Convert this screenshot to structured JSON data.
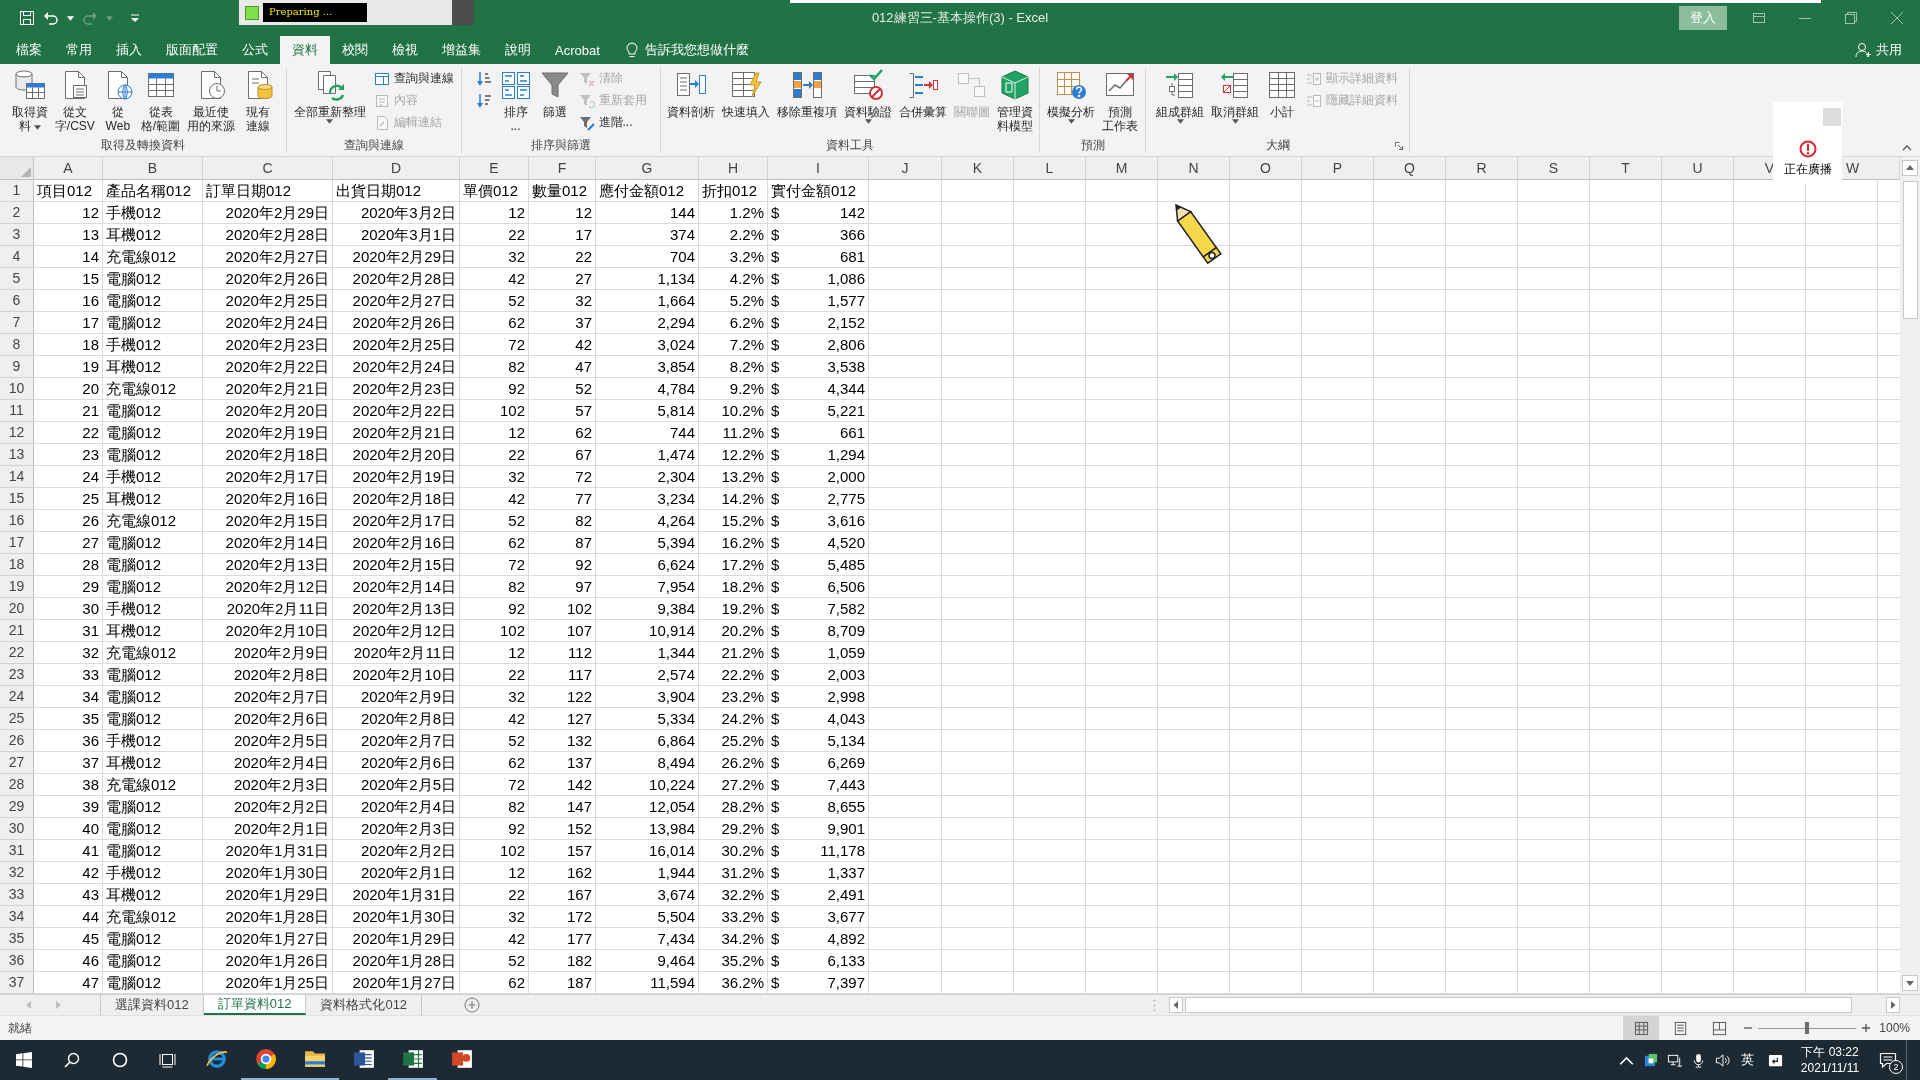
{
  "title_bar": {
    "recorder_status": "Preparing ...",
    "title": "012練習三-基本操作(3) - Excel",
    "sign_in": "登入"
  },
  "tabs": [
    {
      "label": "檔案",
      "selected": false
    },
    {
      "label": "常用",
      "selected": false
    },
    {
      "label": "插入",
      "selected": false
    },
    {
      "label": "版面配置",
      "selected": false
    },
    {
      "label": "公式",
      "selected": false
    },
    {
      "label": "資料",
      "selected": true
    },
    {
      "label": "校閱",
      "selected": false
    },
    {
      "label": "檢視",
      "selected": false
    },
    {
      "label": "增益集",
      "selected": false
    },
    {
      "label": "說明",
      "selected": false
    },
    {
      "label": "Acrobat",
      "selected": false
    }
  ],
  "tell_me": "告訴我您想做什麼",
  "share": "共用",
  "ribbon": [
    {
      "label": "取得及轉換資料",
      "launcher": false,
      "items": [
        {
          "kind": "large",
          "lines": [
            "取得資",
            "料"
          ],
          "dropdown": true,
          "disabled": false
        },
        {
          "kind": "large",
          "lines": [
            "從文",
            "字/CSV"
          ],
          "dropdown": false,
          "disabled": false
        },
        {
          "kind": "large",
          "lines": [
            "從",
            "Web"
          ],
          "dropdown": false,
          "disabled": false
        },
        {
          "kind": "large",
          "lines": [
            "從表",
            "格/範圍"
          ],
          "dropdown": false,
          "disabled": false
        },
        {
          "kind": "large",
          "lines": [
            "最近使",
            "用的來源"
          ],
          "dropdown": false,
          "disabled": false
        },
        {
          "kind": "large",
          "lines": [
            "現有",
            "連線"
          ],
          "dropdown": false,
          "disabled": false
        }
      ]
    },
    {
      "label": "查詢與連線",
      "launcher": false,
      "items": [
        {
          "kind": "large",
          "lines": [
            "全部重新整理"
          ],
          "dropdown": true,
          "disabled": false
        },
        {
          "kind": "stack",
          "items": [
            {
              "label": "查詢與連線",
              "disabled": false
            },
            {
              "label": "內容",
              "disabled": true
            },
            {
              "label": "編輯連結",
              "disabled": true
            }
          ]
        }
      ]
    },
    {
      "label": "排序與篩選",
      "launcher": false,
      "items": [
        {
          "kind": "stack",
          "items": [
            {
              "disabled": false
            },
            {
              "disabled": false
            }
          ]
        },
        {
          "kind": "large",
          "lines": [
            "排序",
            "..."
          ],
          "dropdown": false,
          "disabled": false
        },
        {
          "kind": "large",
          "lines": [
            "篩選"
          ],
          "dropdown": false,
          "disabled": false
        },
        {
          "kind": "stack",
          "items": [
            {
              "label": "清除",
              "disabled": true
            },
            {
              "label": "重新套用",
              "disabled": true
            },
            {
              "label": "進階...",
              "disabled": false
            }
          ]
        }
      ]
    },
    {
      "label": "資料工具",
      "launcher": false,
      "items": [
        {
          "kind": "large",
          "lines": [
            "資料剖析"
          ],
          "dropdown": false,
          "disabled": false
        },
        {
          "kind": "large",
          "lines": [
            "快速填入"
          ],
          "dropdown": false,
          "disabled": false
        },
        {
          "kind": "large",
          "lines": [
            "移除重複項"
          ],
          "dropdown": false,
          "disabled": false
        },
        {
          "kind": "large",
          "lines": [
            "資料驗證"
          ],
          "dropdown": true,
          "disabled": false
        },
        {
          "kind": "large",
          "lines": [
            "合併彙算"
          ],
          "dropdown": false,
          "disabled": false
        },
        {
          "kind": "large",
          "lines": [
            "關聯圖"
          ],
          "dropdown": false,
          "disabled": true
        },
        {
          "kind": "large",
          "lines": [
            "管理資",
            "料模型"
          ],
          "dropdown": false,
          "disabled": false
        }
      ]
    },
    {
      "label": "預測",
      "launcher": false,
      "items": [
        {
          "kind": "large",
          "lines": [
            "模擬分析"
          ],
          "dropdown": true,
          "disabled": false
        },
        {
          "kind": "large",
          "lines": [
            "預測",
            "工作表"
          ],
          "dropdown": false,
          "disabled": false
        }
      ]
    },
    {
      "label": "大綱",
      "launcher": true,
      "items": [
        {
          "kind": "large",
          "lines": [
            "組成群組"
          ],
          "dropdown": true,
          "disabled": false
        },
        {
          "kind": "large",
          "lines": [
            "取消群組"
          ],
          "dropdown": true,
          "disabled": false
        },
        {
          "kind": "large",
          "lines": [
            "小計"
          ],
          "dropdown": false,
          "disabled": false
        },
        {
          "kind": "stack",
          "items": [
            {
              "label": "顯示詳細資料",
              "disabled": true
            },
            {
              "label": "隱藏詳細資料",
              "disabled": true
            }
          ]
        }
      ]
    }
  ],
  "broadcast": {
    "label": "正在廣播"
  },
  "columns": [
    "A",
    "B",
    "C",
    "D",
    "E",
    "F",
    "G",
    "H",
    "I",
    "J",
    "K",
    "L",
    "M",
    "N",
    "O",
    "P",
    "Q",
    "R",
    "S",
    "T",
    "U",
    "V",
    "W"
  ],
  "header_row": {
    "number": "1",
    "cells": [
      "項目012",
      "產品名稱012",
      "訂單日期012",
      "出貨日期012",
      "單價012",
      "數量012",
      "應付金額012",
      "折扣012",
      "實付金額012"
    ]
  },
  "rows": [
    {
      "number": "2",
      "cells": [
        "12",
        "手機012",
        "2020年2月29日",
        "2020年3月2日",
        "12",
        "12",
        "144",
        "1.2%"
      ],
      "currency": "$",
      "amount": "142"
    },
    {
      "number": "3",
      "cells": [
        "13",
        "耳機012",
        "2020年2月28日",
        "2020年3月1日",
        "22",
        "17",
        "374",
        "2.2%"
      ],
      "currency": "$",
      "amount": "366"
    },
    {
      "number": "4",
      "cells": [
        "14",
        "充電線012",
        "2020年2月27日",
        "2020年2月29日",
        "32",
        "22",
        "704",
        "3.2%"
      ],
      "currency": "$",
      "amount": "681"
    },
    {
      "number": "5",
      "cells": [
        "15",
        "電腦012",
        "2020年2月26日",
        "2020年2月28日",
        "42",
        "27",
        "1,134",
        "4.2%"
      ],
      "currency": "$",
      "amount": "1,086"
    },
    {
      "number": "6",
      "cells": [
        "16",
        "電腦012",
        "2020年2月25日",
        "2020年2月27日",
        "52",
        "32",
        "1,664",
        "5.2%"
      ],
      "currency": "$",
      "amount": "1,577"
    },
    {
      "number": "7",
      "cells": [
        "17",
        "電腦012",
        "2020年2月24日",
        "2020年2月26日",
        "62",
        "37",
        "2,294",
        "6.2%"
      ],
      "currency": "$",
      "amount": "2,152"
    },
    {
      "number": "8",
      "cells": [
        "18",
        "手機012",
        "2020年2月23日",
        "2020年2月25日",
        "72",
        "42",
        "3,024",
        "7.2%"
      ],
      "currency": "$",
      "amount": "2,806"
    },
    {
      "number": "9",
      "cells": [
        "19",
        "耳機012",
        "2020年2月22日",
        "2020年2月24日",
        "82",
        "47",
        "3,854",
        "8.2%"
      ],
      "currency": "$",
      "amount": "3,538"
    },
    {
      "number": "10",
      "cells": [
        "20",
        "充電線012",
        "2020年2月21日",
        "2020年2月23日",
        "92",
        "52",
        "4,784",
        "9.2%"
      ],
      "currency": "$",
      "amount": "4,344"
    },
    {
      "number": "11",
      "cells": [
        "21",
        "電腦012",
        "2020年2月20日",
        "2020年2月22日",
        "102",
        "57",
        "5,814",
        "10.2%"
      ],
      "currency": "$",
      "amount": "5,221"
    },
    {
      "number": "12",
      "cells": [
        "22",
        "電腦012",
        "2020年2月19日",
        "2020年2月21日",
        "12",
        "62",
        "744",
        "11.2%"
      ],
      "currency": "$",
      "amount": "661"
    },
    {
      "number": "13",
      "cells": [
        "23",
        "電腦012",
        "2020年2月18日",
        "2020年2月20日",
        "22",
        "67",
        "1,474",
        "12.2%"
      ],
      "currency": "$",
      "amount": "1,294"
    },
    {
      "number": "14",
      "cells": [
        "24",
        "手機012",
        "2020年2月17日",
        "2020年2月19日",
        "32",
        "72",
        "2,304",
        "13.2%"
      ],
      "currency": "$",
      "amount": "2,000"
    },
    {
      "number": "15",
      "cells": [
        "25",
        "耳機012",
        "2020年2月16日",
        "2020年2月18日",
        "42",
        "77",
        "3,234",
        "14.2%"
      ],
      "currency": "$",
      "amount": "2,775"
    },
    {
      "number": "16",
      "cells": [
        "26",
        "充電線012",
        "2020年2月15日",
        "2020年2月17日",
        "52",
        "82",
        "4,264",
        "15.2%"
      ],
      "currency": "$",
      "amount": "3,616"
    },
    {
      "number": "17",
      "cells": [
        "27",
        "電腦012",
        "2020年2月14日",
        "2020年2月16日",
        "62",
        "87",
        "5,394",
        "16.2%"
      ],
      "currency": "$",
      "amount": "4,520"
    },
    {
      "number": "18",
      "cells": [
        "28",
        "電腦012",
        "2020年2月13日",
        "2020年2月15日",
        "72",
        "92",
        "6,624",
        "17.2%"
      ],
      "currency": "$",
      "amount": "5,485"
    },
    {
      "number": "19",
      "cells": [
        "29",
        "電腦012",
        "2020年2月12日",
        "2020年2月14日",
        "82",
        "97",
        "7,954",
        "18.2%"
      ],
      "currency": "$",
      "amount": "6,506"
    },
    {
      "number": "20",
      "cells": [
        "30",
        "手機012",
        "2020年2月11日",
        "2020年2月13日",
        "92",
        "102",
        "9,384",
        "19.2%"
      ],
      "currency": "$",
      "amount": "7,582"
    },
    {
      "number": "21",
      "cells": [
        "31",
        "耳機012",
        "2020年2月10日",
        "2020年2月12日",
        "102",
        "107",
        "10,914",
        "20.2%"
      ],
      "currency": "$",
      "amount": "8,709"
    },
    {
      "number": "22",
      "cells": [
        "32",
        "充電線012",
        "2020年2月9日",
        "2020年2月11日",
        "12",
        "112",
        "1,344",
        "21.2%"
      ],
      "currency": "$",
      "amount": "1,059"
    },
    {
      "number": "23",
      "cells": [
        "33",
        "電腦012",
        "2020年2月8日",
        "2020年2月10日",
        "22",
        "117",
        "2,574",
        "22.2%"
      ],
      "currency": "$",
      "amount": "2,003"
    },
    {
      "number": "24",
      "cells": [
        "34",
        "電腦012",
        "2020年2月7日",
        "2020年2月9日",
        "32",
        "122",
        "3,904",
        "23.2%"
      ],
      "currency": "$",
      "amount": "2,998"
    },
    {
      "number": "25",
      "cells": [
        "35",
        "電腦012",
        "2020年2月6日",
        "2020年2月8日",
        "42",
        "127",
        "5,334",
        "24.2%"
      ],
      "currency": "$",
      "amount": "4,043"
    },
    {
      "number": "26",
      "cells": [
        "36",
        "手機012",
        "2020年2月5日",
        "2020年2月7日",
        "52",
        "132",
        "6,864",
        "25.2%"
      ],
      "currency": "$",
      "amount": "5,134"
    },
    {
      "number": "27",
      "cells": [
        "37",
        "耳機012",
        "2020年2月4日",
        "2020年2月6日",
        "62",
        "137",
        "8,494",
        "26.2%"
      ],
      "currency": "$",
      "amount": "6,269"
    },
    {
      "number": "28",
      "cells": [
        "38",
        "充電線012",
        "2020年2月3日",
        "2020年2月5日",
        "72",
        "142",
        "10,224",
        "27.2%"
      ],
      "currency": "$",
      "amount": "7,443"
    },
    {
      "number": "29",
      "cells": [
        "39",
        "電腦012",
        "2020年2月2日",
        "2020年2月4日",
        "82",
        "147",
        "12,054",
        "28.2%"
      ],
      "currency": "$",
      "amount": "8,655"
    },
    {
      "number": "30",
      "cells": [
        "40",
        "電腦012",
        "2020年2月1日",
        "2020年2月3日",
        "92",
        "152",
        "13,984",
        "29.2%"
      ],
      "currency": "$",
      "amount": "9,901"
    },
    {
      "number": "31",
      "cells": [
        "41",
        "電腦012",
        "2020年1月31日",
        "2020年2月2日",
        "102",
        "157",
        "16,014",
        "30.2%"
      ],
      "currency": "$",
      "amount": "11,178"
    },
    {
      "number": "32",
      "cells": [
        "42",
        "手機012",
        "2020年1月30日",
        "2020年2月1日",
        "12",
        "162",
        "1,944",
        "31.2%"
      ],
      "currency": "$",
      "amount": "1,337"
    },
    {
      "number": "33",
      "cells": [
        "43",
        "耳機012",
        "2020年1月29日",
        "2020年1月31日",
        "22",
        "167",
        "3,674",
        "32.2%"
      ],
      "currency": "$",
      "amount": "2,491"
    },
    {
      "number": "34",
      "cells": [
        "44",
        "充電線012",
        "2020年1月28日",
        "2020年1月30日",
        "32",
        "172",
        "5,504",
        "33.2%"
      ],
      "currency": "$",
      "amount": "3,677"
    },
    {
      "number": "35",
      "cells": [
        "45",
        "電腦012",
        "2020年1月27日",
        "2020年1月29日",
        "42",
        "177",
        "7,434",
        "34.2%"
      ],
      "currency": "$",
      "amount": "4,892"
    },
    {
      "number": "36",
      "cells": [
        "46",
        "電腦012",
        "2020年1月26日",
        "2020年1月28日",
        "52",
        "182",
        "9,464",
        "35.2%"
      ],
      "currency": "$",
      "amount": "6,133"
    },
    {
      "number": "37",
      "cells": [
        "47",
        "電腦012",
        "2020年1月25日",
        "2020年1月27日",
        "62",
        "187",
        "11,594",
        "36.2%"
      ],
      "currency": "$",
      "amount": "7,397"
    }
  ],
  "sheet_tabs": [
    {
      "label": "選課資料012",
      "selected": false
    },
    {
      "label": "訂單資料012",
      "selected": true
    },
    {
      "label": "資料格式化012",
      "selected": false
    }
  ],
  "status": {
    "text": "就緒",
    "views": [
      {
        "selected": true
      },
      {
        "selected": false
      },
      {
        "selected": false
      }
    ],
    "zoom": {
      "level": 0.5,
      "reading": "100%"
    }
  },
  "taskbar": {
    "apps": [
      {
        "running": false
      },
      {
        "running": true
      },
      {
        "running": true
      },
      {
        "running": false
      },
      {
        "running": true
      },
      {
        "running": false
      }
    ],
    "ime": "英",
    "time": "下午 03:22",
    "date": "2021/11/11",
    "notifications": "2"
  }
}
